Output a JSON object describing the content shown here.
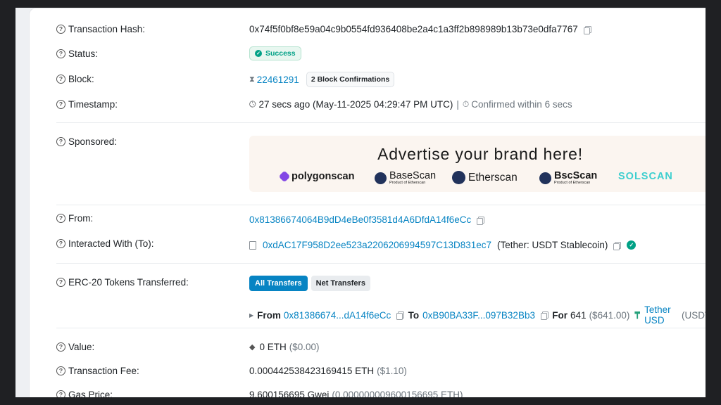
{
  "rows": {
    "tx_hash": {
      "label": "Transaction Hash:",
      "value": "0x74f5f0bf8e59a04c9b0554fd936408be2a4c1a3ff2b898989b13b73e0dfa7767"
    },
    "status": {
      "label": "Status:",
      "value": "Success"
    },
    "block": {
      "label": "Block:",
      "value": "22461291",
      "confirmations": "2 Block Confirmations"
    },
    "timestamp": {
      "label": "Timestamp:",
      "value": "27 secs ago (May-11-2025 04:29:47 PM UTC)",
      "separator": "|",
      "confirmed": "Confirmed within 6 secs"
    },
    "sponsored": {
      "label": "Sponsored:"
    },
    "from": {
      "label": "From:",
      "value": "0x81386674064B9dD4eBe0f3581d4A6DfdA14f6eCc"
    },
    "interacted": {
      "label": "Interacted With (To):",
      "value": "0xdAC17F958D2ee523a2206206994597C13D831ec7",
      "name": "(Tether: USDT Stablecoin)"
    },
    "erc20": {
      "label": "ERC-20 Tokens Transferred:",
      "tabs": [
        "All Transfers",
        "Net Transfers"
      ],
      "transfer": {
        "from_label": "From",
        "from": "0x81386674...dA14f6eCc",
        "to_label": "To",
        "to": "0xB90BA33F...097B32Bb3",
        "for_label": "For",
        "amount": "641",
        "usd": "($641.00)",
        "token": "Tether USD",
        "symbol": "(USDT)"
      }
    },
    "value": {
      "label": "Value:",
      "value": "0 ETH",
      "usd": "($0.00)"
    },
    "fee": {
      "label": "Transaction Fee:",
      "value": "0.000442538423169415 ETH",
      "usd": "($1.10)"
    },
    "gas": {
      "label": "Gas Price:",
      "value": "9.600156695 Gwei",
      "eth": "(0.000000009600156695 ETH)"
    }
  },
  "ad": {
    "headline": "Advertise your brand here!",
    "brands": [
      {
        "name": "polygonscan",
        "color": "#8247e5"
      },
      {
        "name": "BaseScan",
        "sub": "Product of Etherscan",
        "color": "#21325b"
      },
      {
        "name": "Etherscan",
        "color": "#21325b"
      },
      {
        "name": "BscScan",
        "sub": "Product of Etherscan",
        "color": "#21325b"
      },
      {
        "name": "SOLSCAN",
        "color": "#3ecfcf"
      }
    ]
  },
  "colors": {
    "link": "#0784c3",
    "success": "#00a186",
    "tether": "#26a17b"
  }
}
